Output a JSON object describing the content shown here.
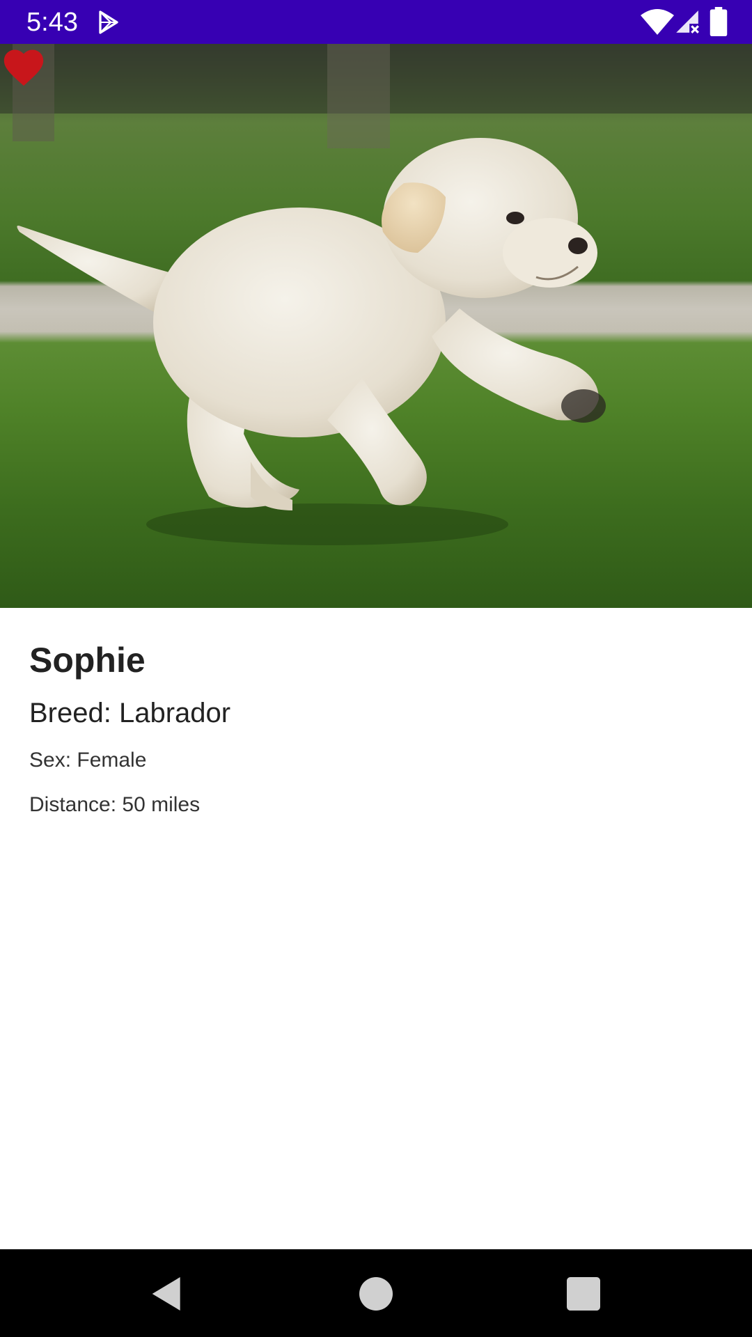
{
  "status_bar": {
    "time": "5:43",
    "background_color": "#3700b3",
    "icons": [
      "play-store-icon",
      "wifi-icon",
      "signal-icon",
      "battery-icon"
    ]
  },
  "hero": {
    "image_subject": "cream labrador puppy running on grass",
    "favorite_icon": "heart-icon",
    "favorite_color": "#c8161b"
  },
  "pet": {
    "name": "Sophie",
    "breed": "Breed: Labrador",
    "sex": "Sex: Female",
    "distance": "Distance: 50 miles"
  },
  "nav_bar": {
    "buttons": [
      "back-icon",
      "home-icon",
      "recents-icon"
    ]
  }
}
